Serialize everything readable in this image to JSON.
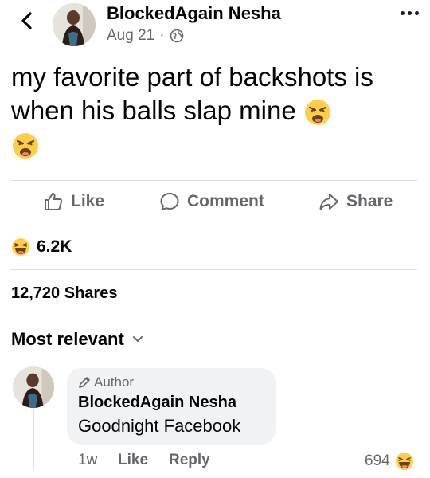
{
  "post": {
    "author": "BlockedAgain Nesha",
    "date": "Aug 21",
    "separator": "·",
    "privacy_icon": "globe-icon",
    "text": "my favorite part of backshots is when his balls slap mine"
  },
  "actions": {
    "like": "Like",
    "comment": "Comment",
    "share": "Share"
  },
  "stats": {
    "reactions": "6.2K",
    "shares": "12,720 Shares"
  },
  "comments_section": {
    "sort_label": "Most relevant"
  },
  "comment": {
    "badge": "Author",
    "author": "BlockedAgain Nesha",
    "text": "Goodnight Facebook",
    "time": "1w",
    "like": "Like",
    "reply": "Reply",
    "reaction_count": "694"
  },
  "colors": {
    "text": "#050505",
    "secondary": "#65676b",
    "bubble": "#f0f2f5",
    "divider": "#dadde1",
    "emoji": "#ffcc4d"
  }
}
